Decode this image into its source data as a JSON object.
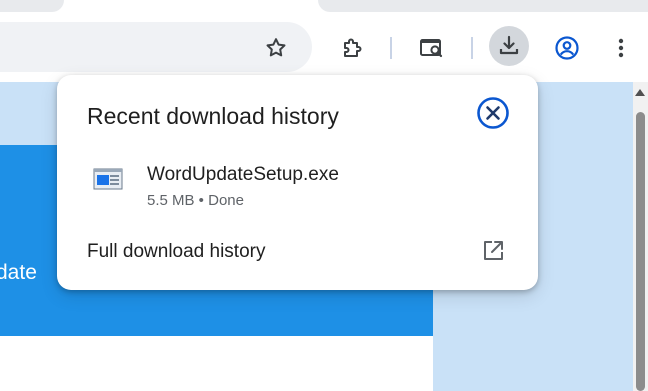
{
  "toolbar": {
    "buttons": [
      {
        "icon": "star-icon"
      },
      {
        "icon": "extensions-icon"
      },
      {
        "icon": "search-tab-icon"
      },
      {
        "icon": "download-icon",
        "active": true
      },
      {
        "icon": "profile-icon"
      },
      {
        "icon": "more-menu-icon"
      }
    ]
  },
  "page": {
    "banner_text_fragment": "date"
  },
  "downloads": {
    "title": "Recent download history",
    "items": [
      {
        "name": "WordUpdateSetup.exe",
        "size": "5.5 MB",
        "status": "Done",
        "meta": "5.5 MB • Done"
      }
    ],
    "full_history_label": "Full download history"
  },
  "colors": {
    "accent": "#0b57d0",
    "banner_blue": "#1e90e6",
    "page_light_blue": "#c9e1f7"
  }
}
